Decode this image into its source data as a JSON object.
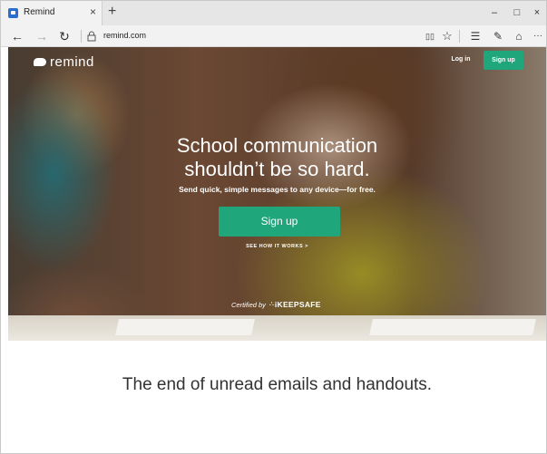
{
  "browser": {
    "tab": {
      "title": "Remind",
      "close": "×",
      "favicon": "remind-favicon"
    },
    "new_tab": "+",
    "window_controls": {
      "minimize": "–",
      "maximize": "□",
      "close": "×"
    },
    "nav": {
      "back": "←",
      "forward": "→",
      "refresh": "↻"
    },
    "address": {
      "url": "remind.com",
      "lock_icon": "lock-icon"
    },
    "toolbar": {
      "reading_view": "▯▯",
      "favorite": "☆",
      "hub": "☰",
      "web_note": "✎",
      "share": "⌂",
      "more": "···"
    }
  },
  "page": {
    "logo_text": "remind",
    "login_label": "Log in",
    "signup_small_label": "Sign up",
    "headline_line1": "School communication",
    "headline_line2": "shouldn’t be so hard.",
    "subhead": "Send quick, simple messages to any device—for free.",
    "signup_label": "Sign up",
    "how_it_works": "SEE HOW IT WORKS >",
    "certified_label": "Certified by",
    "certified_brand": "iKEEPSAFE",
    "tagline": "The end of unread emails and handouts.",
    "accent_color": "#1fa67a"
  }
}
